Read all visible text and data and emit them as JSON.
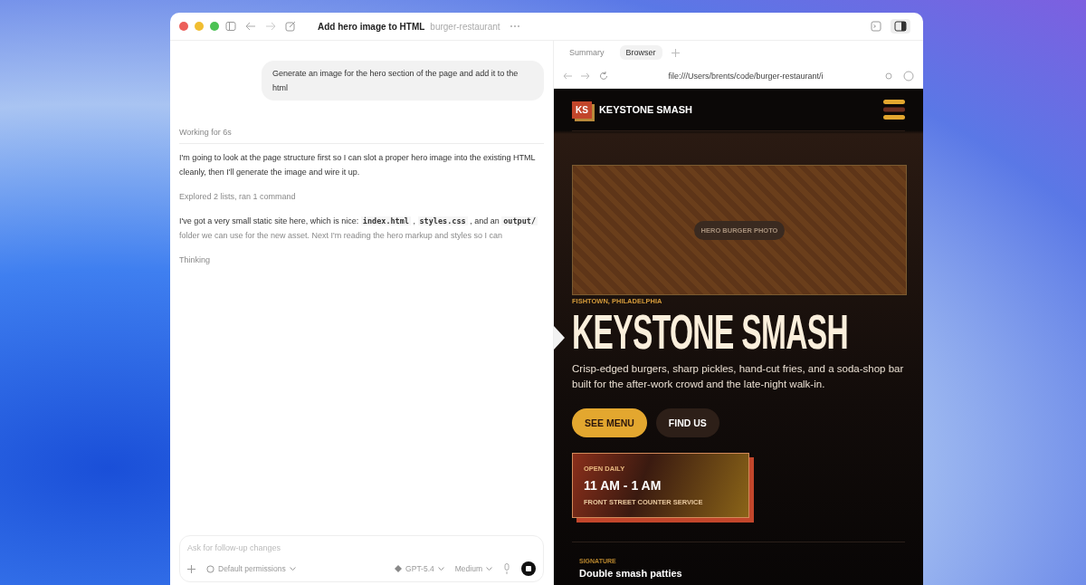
{
  "window": {
    "title": "Add hero image to HTML",
    "project": "burger-restaurant"
  },
  "chat": {
    "user_message": "Generate an image for the hero section of the page and add it to the html",
    "status": "Working for 6s",
    "messages": [
      {
        "kind": "text",
        "segments": [
          {
            "kind": "text",
            "text": "I'm going to look at the page structure first so I can slot a proper hero image into the existing HTML cleanly, then I'll generate the image and wire it up."
          }
        ]
      },
      {
        "kind": "step",
        "segments": [
          {
            "kind": "text",
            "text": "Explored 2 lists, ran 1 command"
          }
        ]
      },
      {
        "kind": "text",
        "segments": [
          {
            "kind": "text",
            "text": "I've got a very small static site here, which is nice: "
          },
          {
            "kind": "code",
            "text": "index.html"
          },
          {
            "kind": "text",
            "text": " , "
          },
          {
            "kind": "code",
            "text": "styles.css"
          },
          {
            "kind": "text",
            "text": " , and an "
          },
          {
            "kind": "code",
            "text": "output/"
          },
          {
            "kind": "fade",
            "text": " folder we can use for the new asset. Next I'm reading the hero markup and styles so I can"
          }
        ]
      },
      {
        "kind": "step",
        "segments": [
          {
            "kind": "text",
            "text": "Thinking"
          }
        ]
      }
    ],
    "composer": {
      "placeholder": "Ask for follow-up changes",
      "permissions": "Default permissions",
      "model": "GPT-5.4",
      "effort": "Medium"
    }
  },
  "panel": {
    "tabs": [
      {
        "label": "Summary",
        "selected": false
      },
      {
        "label": "Browser",
        "selected": true
      }
    ],
    "url": "file:///Users/brents/code/burger-restaurant/i"
  },
  "site": {
    "logo": "KS",
    "brand": "KEYSTONE SMASH",
    "hero_label": "HERO BURGER PHOTO",
    "eyebrow": "FISHTOWN, PHILADELPHIA",
    "title": "KEYSTONE SMASH",
    "lead": "Crisp-edged burgers, sharp pickles, hand-cut fries, and a soda-shop bar built for the after-work crowd and the late-night walk-in.",
    "buttons": [
      {
        "label": "SEE MENU",
        "kind": "primary"
      },
      {
        "label": "FIND US",
        "kind": "secondary"
      }
    ],
    "hours": {
      "label": "OPEN DAILY",
      "time": "11 AM - 1 AM",
      "note": "FRONT STREET COUNTER SERVICE"
    },
    "signature": {
      "label": "SIGNATURE",
      "title": "Double smash patties"
    }
  }
}
